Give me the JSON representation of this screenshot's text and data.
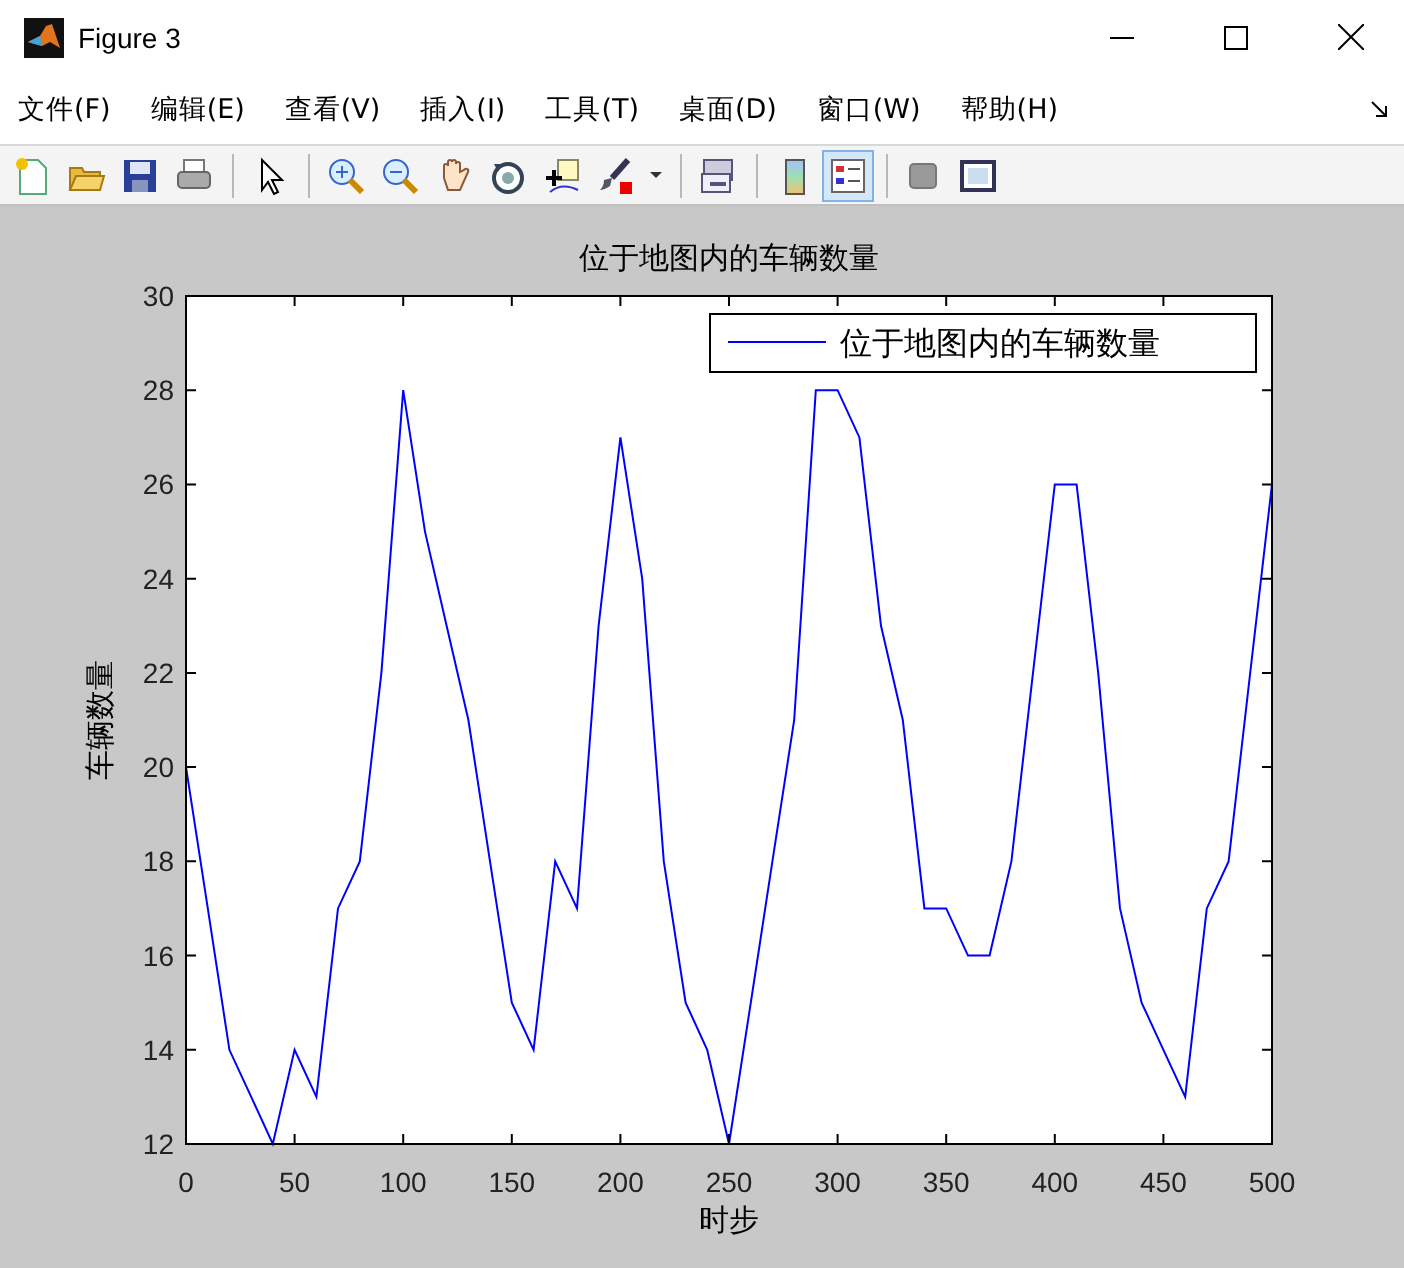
{
  "window": {
    "title": "Figure 3"
  },
  "menu": [
    "文件(F)",
    "编辑(E)",
    "查看(V)",
    "插入(I)",
    "工具(T)",
    "桌面(D)",
    "窗口(W)",
    "帮助(H)"
  ],
  "toolbar": [
    {
      "kind": "new",
      "pressed": false
    },
    {
      "kind": "open",
      "pressed": false
    },
    {
      "kind": "save",
      "pressed": false
    },
    {
      "kind": "print",
      "pressed": false
    },
    {
      "kind": "sep"
    },
    {
      "kind": "pointer",
      "pressed": false
    },
    {
      "kind": "sep"
    },
    {
      "kind": "zoomin",
      "pressed": false
    },
    {
      "kind": "zoomout",
      "pressed": false
    },
    {
      "kind": "pan",
      "pressed": false
    },
    {
      "kind": "rotate",
      "pressed": false
    },
    {
      "kind": "datatip",
      "pressed": false
    },
    {
      "kind": "brush",
      "pressed": false
    },
    {
      "kind": "dropdown",
      "pressed": false
    },
    {
      "kind": "sep"
    },
    {
      "kind": "link",
      "pressed": false
    },
    {
      "kind": "sep"
    },
    {
      "kind": "colorbar",
      "pressed": false
    },
    {
      "kind": "legend",
      "pressed": true
    },
    {
      "kind": "sep"
    },
    {
      "kind": "hide",
      "pressed": false
    },
    {
      "kind": "dock",
      "pressed": false
    }
  ],
  "figure": {
    "chart_data": {
      "type": "line",
      "title": "位于地图内的车辆数量",
      "xlabel": "时步",
      "ylabel": "车辆数量",
      "xlim": [
        0,
        500
      ],
      "ylim": [
        12,
        30
      ],
      "xticks": [
        0,
        50,
        100,
        150,
        200,
        250,
        300,
        350,
        400,
        450,
        500
      ],
      "yticks": [
        12,
        14,
        16,
        18,
        20,
        22,
        24,
        26,
        28,
        30
      ],
      "x": [
        0,
        10,
        20,
        30,
        40,
        50,
        60,
        70,
        80,
        90,
        100,
        110,
        120,
        130,
        140,
        150,
        160,
        170,
        180,
        190,
        200,
        210,
        220,
        230,
        240,
        250,
        260,
        270,
        280,
        290,
        300,
        310,
        320,
        330,
        340,
        350,
        360,
        370,
        380,
        390,
        400,
        410,
        420,
        430,
        440,
        450,
        460,
        470,
        480,
        490,
        500
      ],
      "series": [
        {
          "name": "位于地图内的车辆数量",
          "color": "#0000ff",
          "values": [
            20,
            17,
            14,
            13,
            12,
            14,
            13,
            17,
            18,
            22,
            28,
            25,
            23,
            21,
            18,
            15,
            14,
            18,
            17,
            23,
            27,
            24,
            18,
            15,
            14,
            12,
            15,
            18,
            21,
            28,
            28,
            27,
            23,
            21,
            17,
            17,
            16,
            16,
            18,
            22,
            26,
            26,
            22,
            17,
            15,
            14,
            13,
            17,
            18,
            22,
            26
          ]
        }
      ]
    }
  }
}
